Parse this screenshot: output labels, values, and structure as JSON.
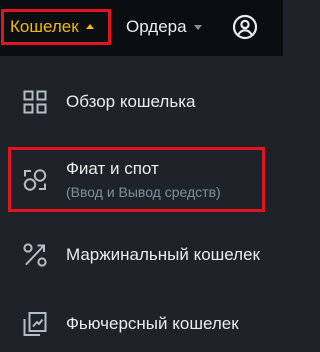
{
  "nav": {
    "wallet_label": "Кошелек",
    "orders_label": "Ордера"
  },
  "menu": {
    "items": [
      {
        "title": "Обзор кошелька",
        "icon": "grid-icon"
      },
      {
        "title": "Фиат и спот",
        "subtitle": "(Ввод и Вывод средств)",
        "icon": "exchange-icon",
        "highlighted": true
      },
      {
        "title": "Маржинальный кошелек",
        "icon": "percent-icon"
      },
      {
        "title": "Фьючерсный кошелек",
        "icon": "futures-icon"
      }
    ]
  },
  "colors": {
    "accent": "#f0b90b",
    "highlight_border": "#e0151f",
    "topbar_bg": "#0b0e11",
    "menu_bg": "#1e2329",
    "text": "#eaecef",
    "muted": "#848e9c"
  }
}
